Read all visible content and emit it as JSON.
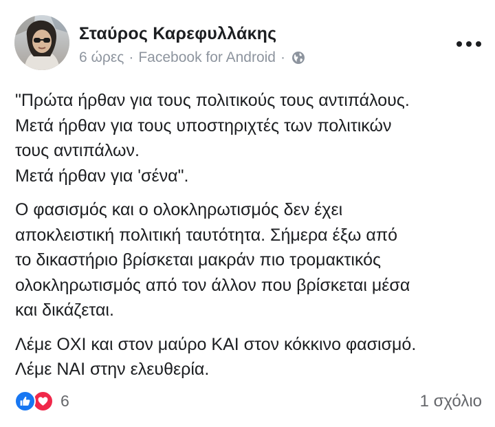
{
  "post": {
    "author": "Σταύρος Καρεφυλλάκης",
    "time": "6 ώρες",
    "source": "Facebook for Android",
    "separator": "·",
    "audience_icon": "globe-icon",
    "menu_icon": "more-options-icon",
    "avatar_icon": "avatar"
  },
  "content": {
    "paragraphs": [
      {
        "lines": [
          "\"Πρώτα ήρθαν για τους πολιτικούς τους αντιπάλους.",
          "Μετά ήρθαν για τους υποστηριχτές των πολιτικών",
          "τους αντιπάλων.",
          "Μετά ήρθαν για 'σένα\"."
        ]
      },
      {
        "lines": [
          "Ο φασισμός και ο ολοκληρωτισμός δεν έχει",
          "αποκλειστική πολιτική ταυτότητα. Σήμερα έξω από",
          "το δικαστήριο βρίσκεται μακράν πιο τρομακτικός",
          "ολοκληρωτισμός από τον άλλον που βρίσκεται μέσα",
          "και δικάζεται."
        ]
      },
      {
        "lines": [
          "Λέμε ΟΧΙ και στον μαύρο ΚΑΙ στον κόκκινο φασισμό.",
          "Λέμε ΝΑΙ στην ελευθερία."
        ]
      }
    ]
  },
  "footer": {
    "reaction_count": "6",
    "comments": "1 σχόλιο",
    "reactions": [
      "like-icon",
      "love-icon"
    ]
  },
  "colors": {
    "text": "#1c1e21",
    "meta": "#8d949e",
    "like": "#1877f2",
    "love": "#f0284a"
  }
}
